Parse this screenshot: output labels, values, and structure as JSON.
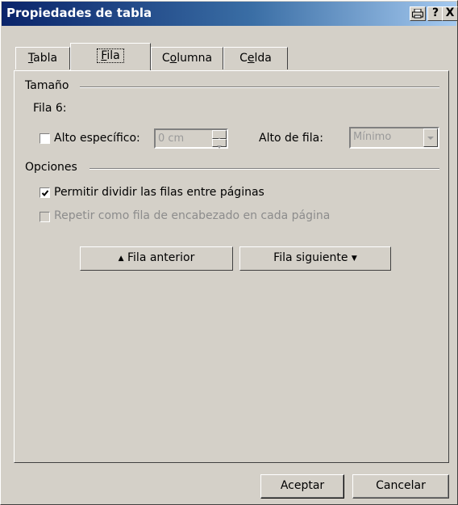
{
  "window": {
    "title": "Propiedades de tabla",
    "help_label": "?",
    "close_label": "X"
  },
  "tabs": [
    {
      "label": "Tabla",
      "mnemonic_index": 0
    },
    {
      "label": "Fila",
      "mnemonic_index": 0,
      "active": true
    },
    {
      "label": "Columna",
      "mnemonic_index": 1
    },
    {
      "label": "Celda",
      "mnemonic_index": 1
    }
  ],
  "size_group": {
    "title": "Tamaño",
    "row_label": "Fila 6:",
    "specific_height": {
      "label": "Alto específico:",
      "checked": false
    },
    "height_value": "0 cm",
    "row_height_label": "Alto de fila:",
    "row_height_value": "Mínimo"
  },
  "options_group": {
    "title": "Opciones",
    "allow_split": {
      "label": "Permitir dividir las filas entre páginas",
      "checked": true
    },
    "repeat_header": {
      "label": "Repetir como fila de encabezado en cada página",
      "checked": false,
      "disabled": true
    }
  },
  "nav": {
    "prev_label": "Fila anterior",
    "next_label": "Fila siguiente"
  },
  "footer": {
    "ok_label": "Aceptar",
    "cancel_label": "Cancelar"
  }
}
